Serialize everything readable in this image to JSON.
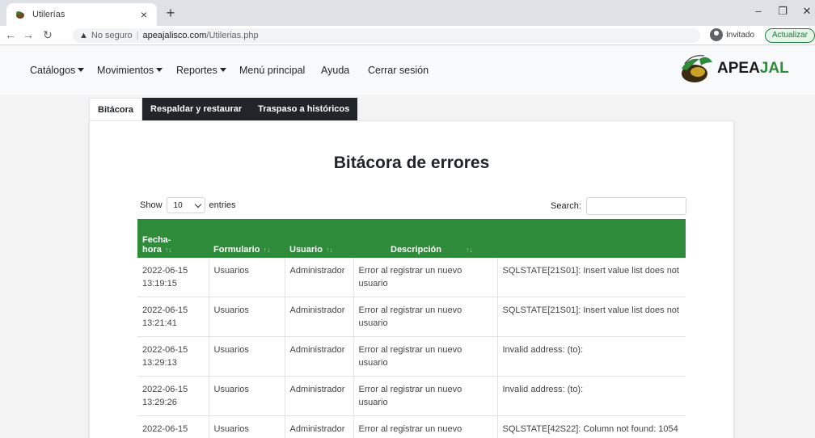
{
  "browser": {
    "tab_title": "Utilerías",
    "new_tab": "+",
    "tab_close": "×",
    "url_warning": "No seguro",
    "url_domain": "apeajalisco.com",
    "url_path": "/Utilerias.php",
    "profile_label": "Invitado",
    "update_label": "Actualizar"
  },
  "nav": {
    "catalogos": "Catálogos",
    "movimientos": "Movimientos",
    "reportes": "Reportes",
    "menu_principal": "Menú principal",
    "ayuda": "Ayuda",
    "cerrar_sesion": "Cerrar sesión",
    "logo_text_a": "APEA",
    "logo_text_b": "JAL"
  },
  "tabs": [
    "Bitácora",
    "Respaldar y restaurar",
    "Traspaso a históricos"
  ],
  "page": {
    "title": "Bitácora de errores",
    "show": "Show",
    "entries_value": "10",
    "entries": "entries",
    "search": "Search:"
  },
  "table": {
    "headers": [
      "Fecha-hora",
      "Formulario",
      "Usuario",
      "Descripción",
      ""
    ],
    "header_line1": "Fecha-",
    "header_line2": "hora",
    "rows": [
      {
        "fecha": "2022-06-15",
        "hora": "13:19:15",
        "formulario": "Usuarios",
        "usuario": "Administrador",
        "descripcion": "Error al registrar un nuevo usuario",
        "detalle": "SQLSTATE[21S01]: Insert value list does not"
      },
      {
        "fecha": "2022-06-15",
        "hora": "13:21:41",
        "formulario": "Usuarios",
        "usuario": "Administrador",
        "descripcion": "Error al registrar un nuevo usuario",
        "detalle": "SQLSTATE[21S01]: Insert value list does not"
      },
      {
        "fecha": "2022-06-15",
        "hora": "13:29:13",
        "formulario": "Usuarios",
        "usuario": "Administrador",
        "descripcion": "Error al registrar un nuevo usuario",
        "detalle": "Invalid address: (to):"
      },
      {
        "fecha": "2022-06-15",
        "hora": "13:29:26",
        "formulario": "Usuarios",
        "usuario": "Administrador",
        "descripcion": "Error al registrar un nuevo usuario",
        "detalle": "Invalid address: (to):"
      },
      {
        "fecha": "2022-06-15",
        "hora": "",
        "formulario": "Usuarios",
        "usuario": "Administrador",
        "descripcion": "Error al registrar un nuevo usuario",
        "detalle": "SQLSTATE[42S22]: Column not found: 1054"
      }
    ]
  },
  "colors": {
    "header_green": "#2e8b3a",
    "dark_tab": "#212529"
  }
}
